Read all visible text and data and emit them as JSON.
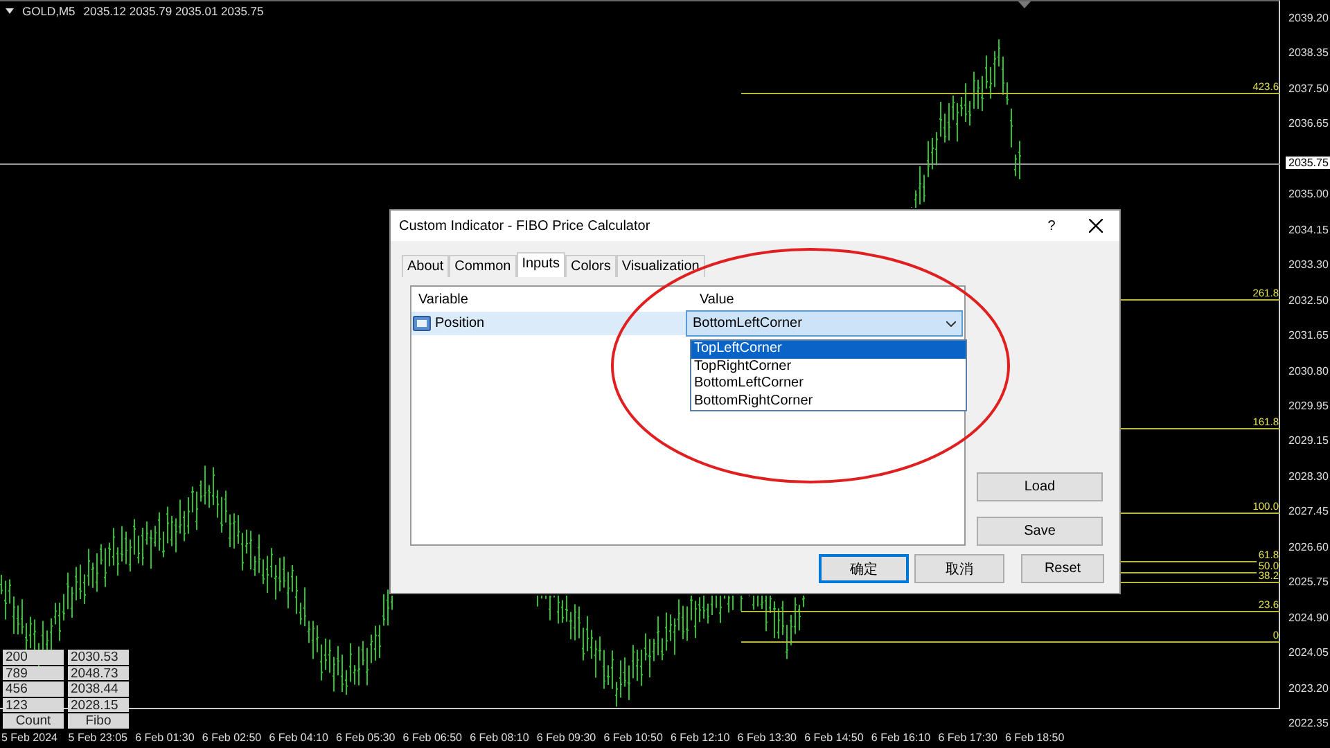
{
  "chart": {
    "header": {
      "symbol": "GOLD,M5",
      "quotes": "2035.12 2035.79 2035.01 2035.75"
    },
    "price_axis": [
      "2039.20",
      "2038.35",
      "2037.50",
      "2036.65",
      "2035.00",
      "2034.15",
      "2033.30",
      "2032.50",
      "2031.65",
      "2030.80",
      "2029.95",
      "2029.15",
      "2028.30",
      "2027.45",
      "2026.60",
      "2025.75",
      "2024.90",
      "2024.05",
      "2023.20",
      "2022.35"
    ],
    "current_price": "2035.75",
    "time_axis": [
      "5 Feb 2024",
      "5 Feb 23:05",
      "6 Feb 01:30",
      "6 Feb 02:50",
      "6 Feb 04:10",
      "6 Feb 05:30",
      "6 Feb 06:50",
      "6 Feb 08:10",
      "6 Feb 09:30",
      "6 Feb 10:50",
      "6 Feb 12:10",
      "6 Feb 13:30",
      "6 Feb 14:50",
      "6 Feb 16:10",
      "6 Feb 17:30",
      "6 Feb 18:50"
    ],
    "fibo_levels": [
      {
        "label": "423.6"
      },
      {
        "label": "261.8"
      },
      {
        "label": "161.8"
      },
      {
        "label": "100.0"
      },
      {
        "label": "61.8"
      },
      {
        "label": "50.0"
      },
      {
        "label": "38.2"
      },
      {
        "label": "23.6"
      },
      {
        "label": "0"
      }
    ],
    "table": {
      "rows": [
        [
          "200",
          "2030.53"
        ],
        [
          "789",
          "2048.73"
        ],
        [
          "456",
          "2038.44"
        ],
        [
          "123",
          "2028.15"
        ]
      ],
      "footer": [
        "Count",
        "Fibo"
      ]
    }
  },
  "dialog": {
    "title": "Custom Indicator - FIBO Price Calculator",
    "help": "?",
    "tabs": [
      {
        "label": "About",
        "selected": false
      },
      {
        "label": "Common",
        "selected": false
      },
      {
        "label": "Inputs",
        "selected": true
      },
      {
        "label": "Colors",
        "selected": false
      },
      {
        "label": "Visualization",
        "selected": false
      }
    ],
    "columns": [
      "Variable",
      "Value"
    ],
    "rows": [
      {
        "name": "Position",
        "value": "BottomLeftCorner",
        "selected": true
      }
    ],
    "dropdown_options": [
      {
        "label": "TopLeftCorner",
        "selected": true
      },
      {
        "label": "TopRightCorner",
        "selected": false
      },
      {
        "label": "BottomLeftCorner",
        "selected": false
      },
      {
        "label": "BottomRightCorner",
        "selected": false
      }
    ],
    "side_buttons": [
      "Load",
      "Save"
    ],
    "buttons": [
      {
        "label": "确定",
        "default": true
      },
      {
        "label": "取消",
        "default": false
      },
      {
        "label": "Reset",
        "default": false
      }
    ]
  }
}
